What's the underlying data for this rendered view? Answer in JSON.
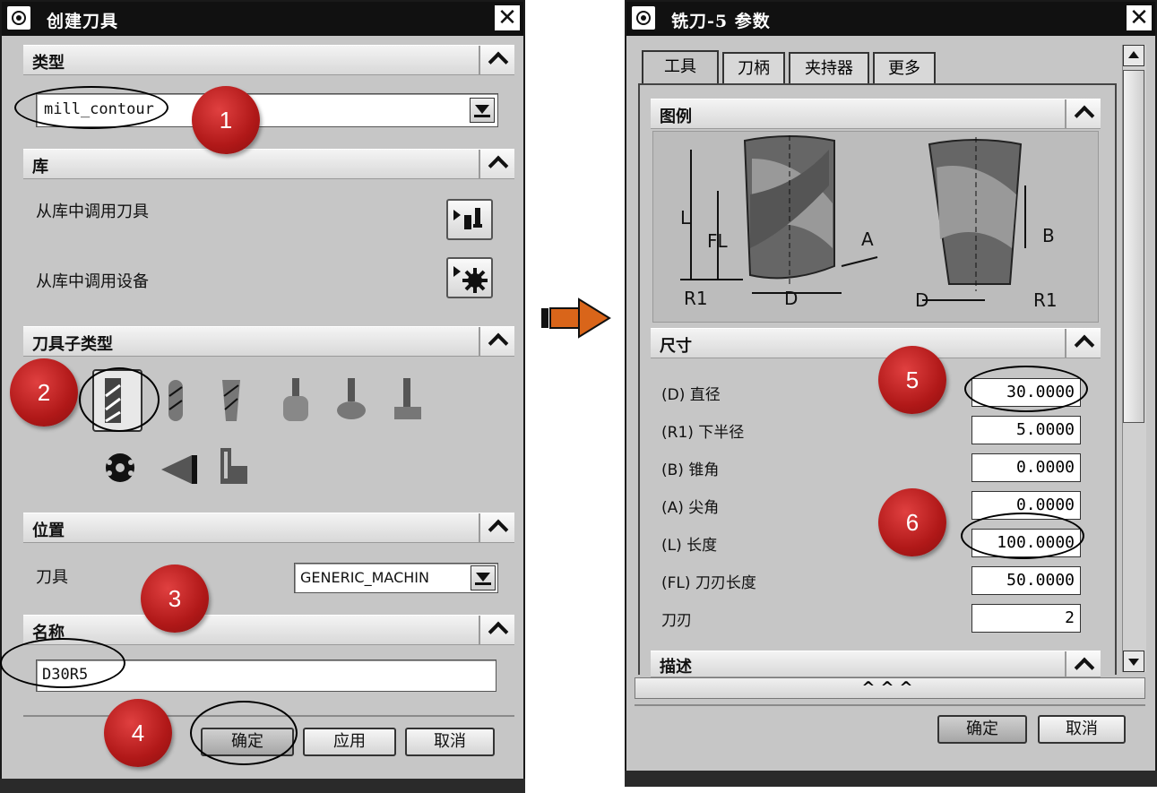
{
  "left_dialog": {
    "title": "创建刀具",
    "type_section": {
      "label": "类型",
      "value": "mill_contour"
    },
    "library_section": {
      "label": "库",
      "items": [
        "从库中调用刀具",
        "从库中调用设备"
      ]
    },
    "subtype_section": {
      "label": "刀具子类型"
    },
    "location_section": {
      "label": "位置",
      "tool_label": "刀具",
      "tool_value": "GENERIC_MACHIN"
    },
    "name_section": {
      "label": "名称",
      "value": "D30R5"
    },
    "buttons": {
      "ok": "确定",
      "apply": "应用",
      "cancel": "取消"
    }
  },
  "right_dialog": {
    "title": "铣刀-5 参数",
    "tabs": [
      "工具",
      "刀柄",
      "夹持器",
      "更多"
    ],
    "legend_section": {
      "label": "图例"
    },
    "diagram_labels": {
      "L": "L",
      "FL": "FL",
      "A": "A",
      "B": "B",
      "D_left": "D",
      "D_right": "D",
      "R1_left": "R1",
      "R1_right": "R1"
    },
    "dimensions_section": {
      "label": "尺寸",
      "rows": [
        {
          "label": "(D) 直径",
          "value": "30.0000"
        },
        {
          "label": "(R1) 下半径",
          "value": "5.0000"
        },
        {
          "label": "(B) 锥角",
          "value": "0.0000"
        },
        {
          "label": "(A) 尖角",
          "value": "0.0000"
        },
        {
          "label": "(L) 长度",
          "value": "100.0000"
        },
        {
          "label": "(FL) 刀刃长度",
          "value": "50.0000"
        },
        {
          "label": "刀刃",
          "value": "2"
        }
      ]
    },
    "description_section": {
      "label": "描述"
    },
    "expand_glyph": "^^^",
    "buttons": {
      "ok": "确定",
      "cancel": "取消"
    }
  },
  "step_badges": [
    "1",
    "2",
    "3",
    "4",
    "5",
    "6"
  ],
  "colors": {
    "badge_red": "#c0201f",
    "arrow_orange": "#d9651a",
    "dialog_bg": "#c6c6c6",
    "titlebar": "#111111"
  }
}
